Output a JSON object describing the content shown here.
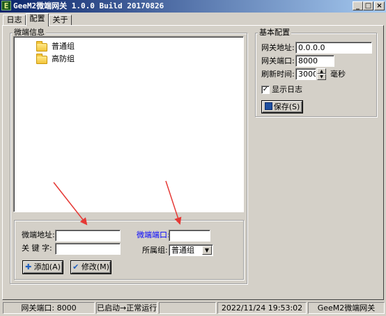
{
  "window": {
    "app_icon_letter": "E",
    "title": "GeeM2微端网关 1.0.0 Build 20170826",
    "controls": [
      "_",
      "□",
      "×"
    ]
  },
  "tabs": [
    {
      "label": "日志",
      "active": false
    },
    {
      "label": "配置",
      "active": true
    },
    {
      "label": "关于",
      "active": false
    }
  ],
  "microclient_info": {
    "group_label": "微端信息",
    "tree_items": [
      {
        "label": "普通组",
        "icon": "folder-icon"
      },
      {
        "label": "高防组",
        "icon": "folder-icon"
      }
    ],
    "address_label": "微端地址:",
    "address_value": "",
    "port_label": "微端端口:",
    "port_value": "",
    "keyword_label": "关 键 字:",
    "keyword_value": "",
    "group_select_label": "所属组:",
    "group_select_value": "普通组",
    "add_button": "添加(A)",
    "modify_button": "修改(M)",
    "port_label_color": "#0000ff"
  },
  "basic_config": {
    "group_label": "基本配置",
    "gateway_address_label": "网关地址:",
    "gateway_address_value": "0.0.0.0",
    "gateway_port_label": "网关端口:",
    "gateway_port_value": "8000",
    "refresh_label": "刷新时间:",
    "refresh_value": "3000",
    "refresh_unit": "毫秒",
    "show_log_label": "显示日志",
    "show_log_checked": true,
    "save_button": "保存(S)"
  },
  "statusbar": {
    "gateway_port": "网关端口: 8000",
    "status": "已启动→正常运行",
    "extra": "",
    "datetime": "2022/11/24 19:53:02",
    "app_name": "GeeM2微端网关"
  },
  "annotation_color": "#e53935"
}
